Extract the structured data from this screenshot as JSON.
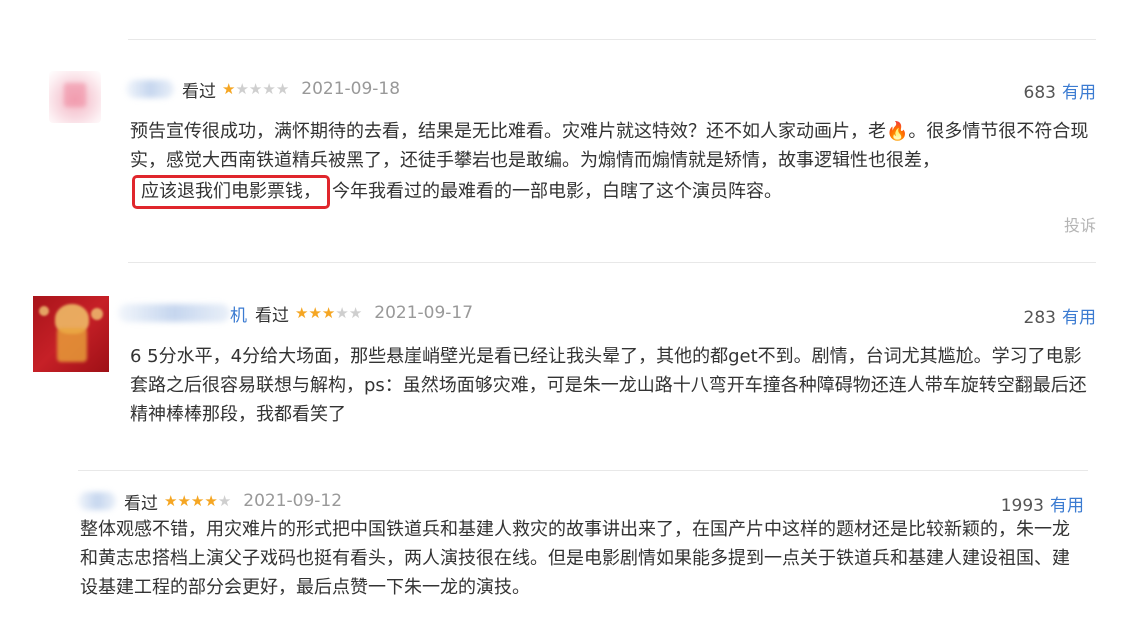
{
  "reviews": [
    {
      "name_suffix": "",
      "watched": "看过",
      "stars": 1,
      "date": "2021-09-18",
      "useful_count": "683",
      "useful_label": "有用",
      "text_before": "预告宣传很成功，满怀期待的去看，结果是无比难看。灾难片就这特效？还不如人家动画片，老",
      "emoji": "🔥",
      "text_mid": "。很多情节很不符合现实，感觉大西南铁道精兵被黑了，还徒手攀岩也是敢编。为煽情而煽情就是矫情，故事逻辑性也很差，",
      "highlight": "应该退我们电影票钱，",
      "text_after": "今年我看过的最难看的一部电影，白瞎了这个演员阵容。",
      "report": "投诉"
    },
    {
      "name_suffix": "机",
      "watched": "看过",
      "stars": 3,
      "date": "2021-09-17",
      "useful_count": "283",
      "useful_label": "有用",
      "text": "6 5分水平，4分给大场面，那些悬崖峭壁光是看已经让我头晕了，其他的都get不到。剧情，台词尤其尴尬。学习了电影套路之后很容易联想与解构，ps：虽然场面够灾难，可是朱一龙山路十八弯开车撞各种障碍物还连人带车旋转空翻最后还精神棒棒那段，我都看笑了"
    },
    {
      "name_suffix": "",
      "watched": "看过",
      "stars": 4,
      "date": "2021-09-12",
      "useful_count": "1993",
      "useful_label": "有用",
      "text": "整体观感不错，用灾难片的形式把中国铁道兵和基建人救灾的故事讲出来了，在国产片中这样的题材还是比较新颖的，朱一龙和黄志忠搭档上演父子戏码也挺有看头，两人演技很在线。但是电影剧情如果能多提到一点关于铁道兵和基建人建设祖国、建设基建工程的部分会更好，最后点赞一下朱一龙的演技。"
    }
  ],
  "colors": {
    "link": "#3b7bd1",
    "star": "#f5a623",
    "highlight_border": "#e0262c"
  },
  "icons": [
    "star-icon",
    "fire-emoji"
  ]
}
